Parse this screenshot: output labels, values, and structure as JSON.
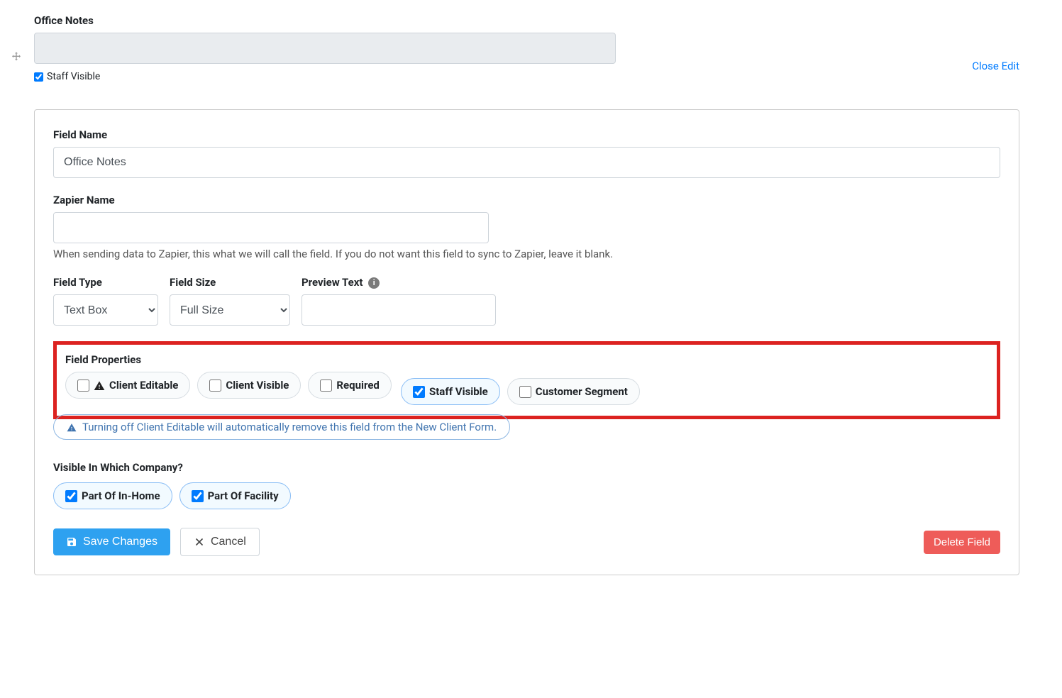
{
  "top": {
    "title": "Office Notes",
    "staff_visible_label": "Staff Visible",
    "close_edit": "Close Edit"
  },
  "form": {
    "field_name_label": "Field Name",
    "field_name_value": "Office Notes",
    "zapier_label": "Zapier Name",
    "zapier_value": "",
    "zapier_help": "When sending data to Zapier, this what we will call the field. If you do not want this field to sync to Zapier, leave it blank.",
    "field_type_label": "Field Type",
    "field_type_value": "Text Box",
    "field_size_label": "Field Size",
    "field_size_value": "Full Size",
    "preview_text_label": "Preview Text",
    "preview_text_value": "",
    "field_props_label": "Field Properties",
    "props": {
      "client_editable": "Client Editable",
      "client_visible": "Client Visible",
      "required": "Required",
      "staff_visible": "Staff Visible",
      "customer_segment": "Customer Segment"
    },
    "notice": "Turning off Client Editable will automatically remove this field from the New Client Form.",
    "company_label": "Visible In Which Company?",
    "company": {
      "in_home": "Part Of In-Home",
      "facility": "Part Of Facility"
    },
    "save": "Save Changes",
    "cancel": "Cancel",
    "delete": "Delete Field"
  }
}
